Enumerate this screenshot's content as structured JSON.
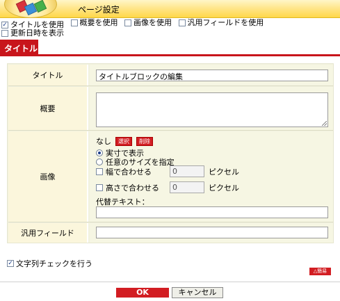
{
  "header": {
    "title": "ページ設定"
  },
  "options": {
    "use_title": {
      "label": "タイトルを使用",
      "checked": true
    },
    "use_summary": {
      "label": "概要を使用",
      "checked": false
    },
    "use_image": {
      "label": "画像を使用",
      "checked": false
    },
    "use_generic_field": {
      "label": "汎用フィールドを使用",
      "checked": false
    },
    "show_updated": {
      "label": "更新日時を表示",
      "checked": false
    }
  },
  "tabs": [
    {
      "label": "タイトル",
      "active": true
    }
  ],
  "form": {
    "title": {
      "label": "タイトル",
      "value": "タイトルブロックの編集"
    },
    "summary": {
      "label": "概要",
      "value": ""
    },
    "image": {
      "label": "画像",
      "current": "なし",
      "select_label": "選択",
      "delete_label": "削除",
      "radio_actual": "実寸で表示",
      "radio_custom": "任意のサイズを指定",
      "fit_width_label": "幅で合わせる",
      "fit_width_value": "0",
      "fit_height_label": "高さで合わせる",
      "fit_height_value": "0",
      "unit": "ピクセル",
      "alt_label": "代替テキスト：",
      "alt_value": ""
    },
    "generic_field": {
      "label": "汎用フィールド",
      "value": ""
    }
  },
  "string_check": {
    "label": "文字列チェックを行う",
    "checked": true
  },
  "help_label": "△簡易",
  "footer": {
    "ok_label": "OK",
    "cancel_label": "キャンセル"
  },
  "colors": {
    "accent_red": "#c8151b",
    "header_yellow": "#ffe27a",
    "panel_bg": "#f1f1df"
  }
}
